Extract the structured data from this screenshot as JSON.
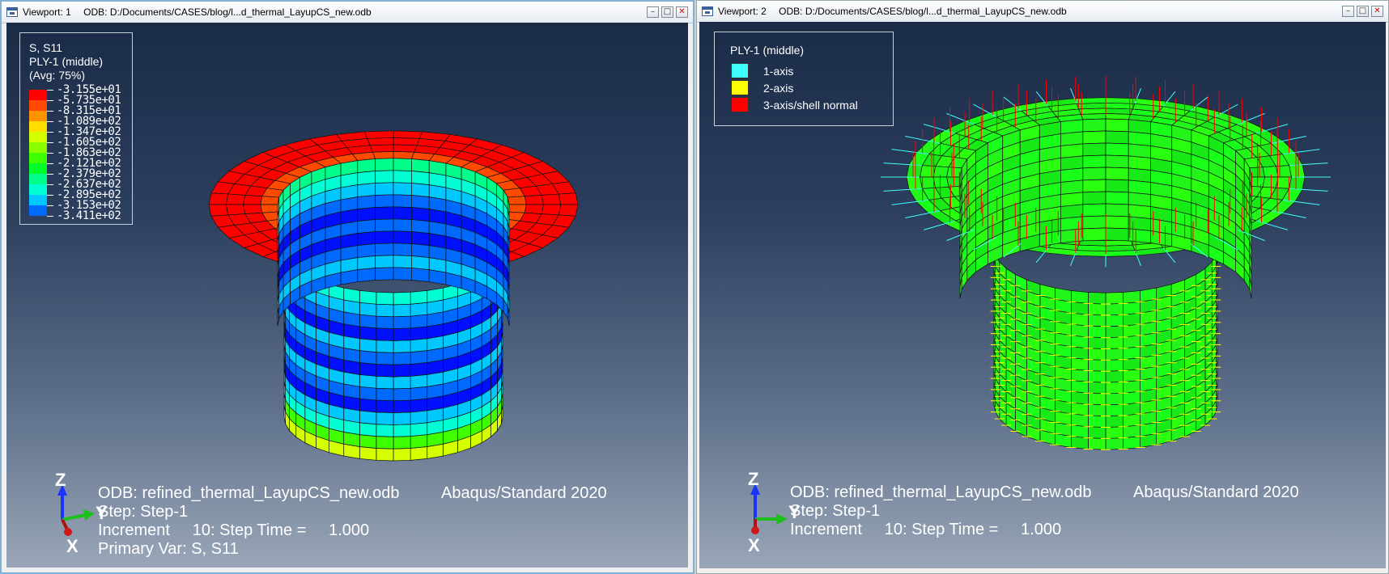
{
  "viewport1": {
    "title": "Viewport: 1",
    "odb_path": "ODB: D:/Documents/CASES/blog/l...d_thermal_LayupCS_new.odb",
    "legend": {
      "lines": [
        "S, S11",
        "PLY-1 (middle)",
        "(Avg: 75%)"
      ],
      "values": [
        "-3.155e+01",
        "-5.735e+01",
        "-8.315e+01",
        "-1.089e+02",
        "-1.347e+02",
        "-1.605e+02",
        "-1.863e+02",
        "-2.121e+02",
        "-2.379e+02",
        "-2.637e+02",
        "-2.895e+02",
        "-3.153e+02",
        "-3.411e+02"
      ],
      "colors": [
        "#ff0000",
        "#ff4a00",
        "#ff9400",
        "#ffde00",
        "#d4ff00",
        "#8aff00",
        "#40ff00",
        "#00ff2a",
        "#00ff8a",
        "#00ffd4",
        "#00c8ff",
        "#006aff",
        "#0010ff"
      ]
    },
    "info": {
      "odb": "ODB: refined_thermal_LayupCS_new.odb",
      "solver": "Abaqus/Standard 2020",
      "step": "Step: Step-1",
      "increment": "Increment     10: Step Time =     1.000",
      "primary_var": "Primary Var: S, S11"
    },
    "triad": {
      "z": "Z",
      "y": "Y",
      "x": "X"
    }
  },
  "viewport2": {
    "title": "Viewport: 2",
    "odb_path": "ODB: D:/Documents/CASES/blog/l...d_thermal_LayupCS_new.odb",
    "legend": {
      "header": "PLY-1 (middle)",
      "items": [
        {
          "label": "1-axis",
          "color": "#40ffff"
        },
        {
          "label": "2-axis",
          "color": "#ffff00"
        },
        {
          "label": "3-axis/shell normal",
          "color": "#ff0000"
        }
      ]
    },
    "info": {
      "odb": "ODB: refined_thermal_LayupCS_new.odb",
      "solver": "Abaqus/Standard 2020",
      "step": "Step: Step-1",
      "increment": "Increment     10: Step Time =     1.000"
    },
    "triad": {
      "z": "Z",
      "y": "Y",
      "x": "X"
    }
  },
  "window_controls": {
    "minimize": "–",
    "restore": "□",
    "close": "✕"
  }
}
